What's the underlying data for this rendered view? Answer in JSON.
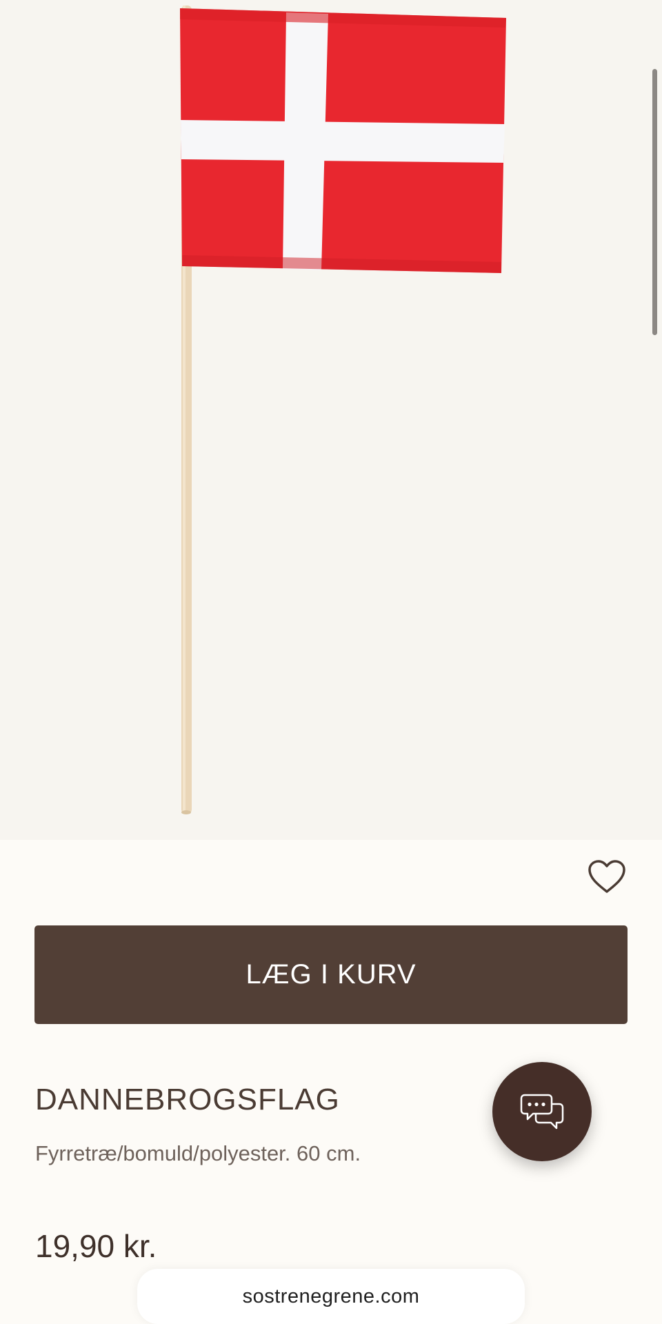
{
  "product": {
    "add_to_cart_label": "LÆG I KURV",
    "title": "DANNEBROGSFLAG",
    "description": "Fyrretræ/bomuld/polyester. 60 cm.",
    "price": "19,90 kr."
  },
  "browser": {
    "url": "sostrenegrene.com"
  },
  "icons": {
    "favorite": "heart-icon",
    "chat": "chat-bubbles-icon"
  },
  "colors": {
    "accent": "#523f36",
    "chat_button": "#452e28",
    "flag_red": "#e8272f",
    "flag_white": "#ffffff"
  }
}
